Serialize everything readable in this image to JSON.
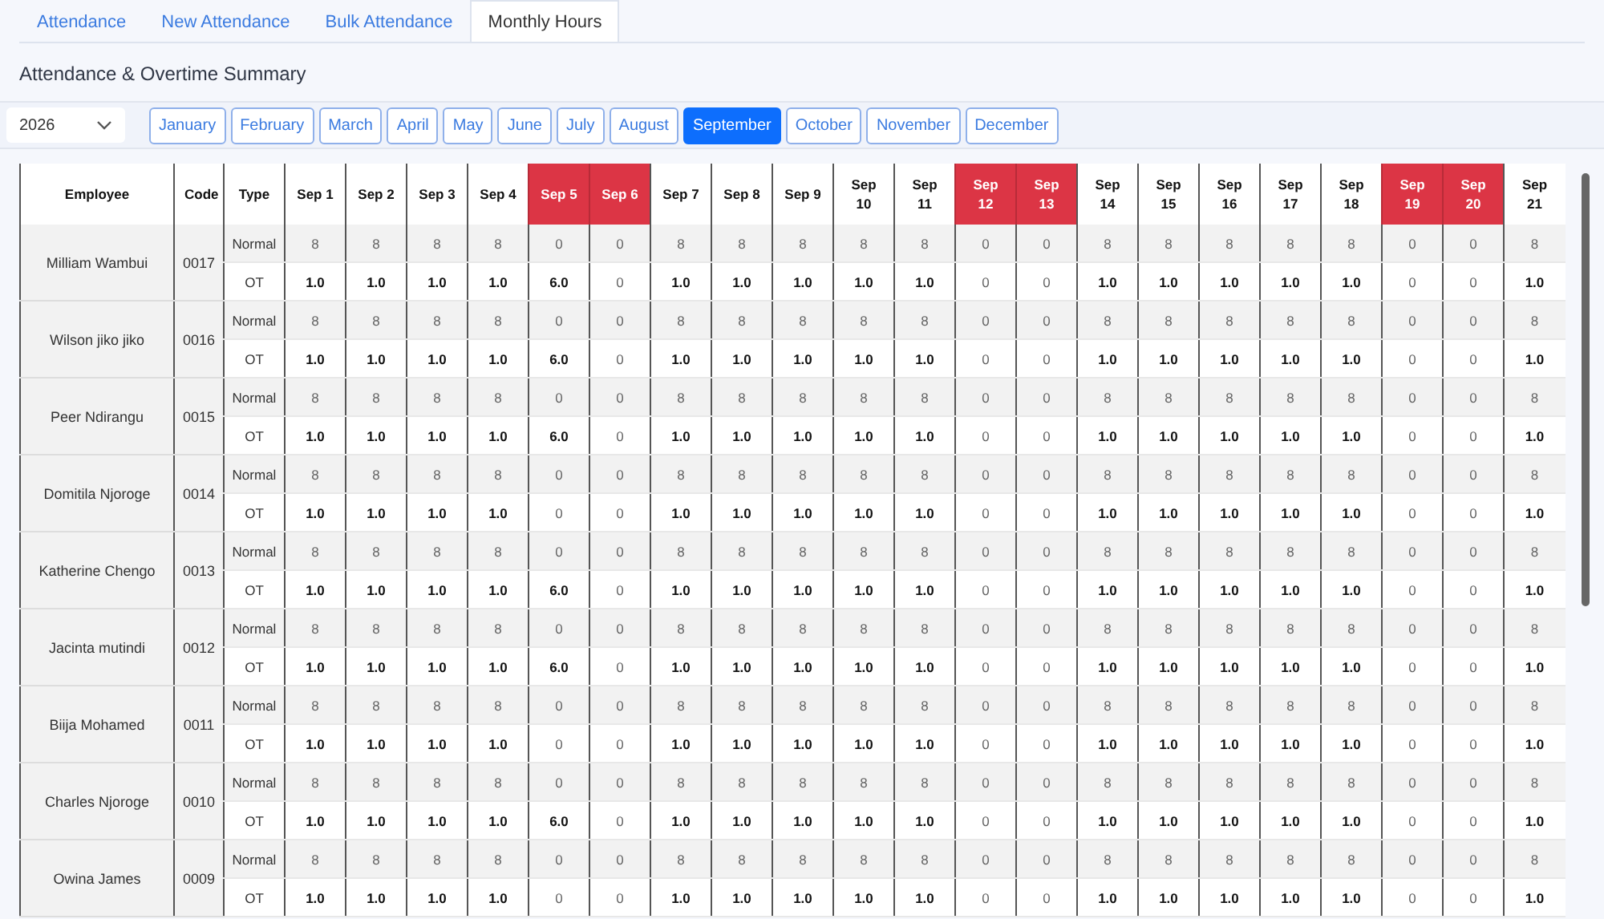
{
  "tabs": [
    {
      "label": "Attendance",
      "selected": false
    },
    {
      "label": "New Attendance",
      "selected": false
    },
    {
      "label": "Bulk Attendance",
      "selected": false
    },
    {
      "label": "Monthly Hours",
      "selected": true
    }
  ],
  "title": "Attendance & Overtime Summary",
  "year": "2026",
  "months": [
    {
      "label": "January",
      "selected": false
    },
    {
      "label": "February",
      "selected": false
    },
    {
      "label": "March",
      "selected": false
    },
    {
      "label": "April",
      "selected": false
    },
    {
      "label": "May",
      "selected": false
    },
    {
      "label": "June",
      "selected": false
    },
    {
      "label": "July",
      "selected": false
    },
    {
      "label": "August",
      "selected": false
    },
    {
      "label": "September",
      "selected": true
    },
    {
      "label": "October",
      "selected": false
    },
    {
      "label": "November",
      "selected": false
    },
    {
      "label": "December",
      "selected": false
    }
  ],
  "table": {
    "columns": [
      "Employee",
      "Code",
      "Type"
    ],
    "days": [
      {
        "label": "Sep 1",
        "weekend": false
      },
      {
        "label": "Sep 2",
        "weekend": false
      },
      {
        "label": "Sep 3",
        "weekend": false
      },
      {
        "label": "Sep 4",
        "weekend": false
      },
      {
        "label": "Sep 5",
        "weekend": true
      },
      {
        "label": "Sep 6",
        "weekend": true
      },
      {
        "label": "Sep 7",
        "weekend": false
      },
      {
        "label": "Sep 8",
        "weekend": false
      },
      {
        "label": "Sep 9",
        "weekend": false
      },
      {
        "label": "Sep 10",
        "weekend": false
      },
      {
        "label": "Sep 11",
        "weekend": false
      },
      {
        "label": "Sep 12",
        "weekend": true
      },
      {
        "label": "Sep 13",
        "weekend": true
      },
      {
        "label": "Sep 14",
        "weekend": false
      },
      {
        "label": "Sep 15",
        "weekend": false
      },
      {
        "label": "Sep 16",
        "weekend": false
      },
      {
        "label": "Sep 17",
        "weekend": false
      },
      {
        "label": "Sep 18",
        "weekend": false
      },
      {
        "label": "Sep 19",
        "weekend": true
      },
      {
        "label": "Sep 20",
        "weekend": true
      },
      {
        "label": "Sep 21",
        "weekend": false
      }
    ],
    "employees": [
      {
        "name": "Milliam Wambui",
        "code": "0017",
        "rows": [
          {
            "type": "Normal",
            "kind": "normal",
            "values": [
              "8",
              "8",
              "8",
              "8",
              "0",
              "0",
              "8",
              "8",
              "8",
              "8",
              "8",
              "0",
              "0",
              "8",
              "8",
              "8",
              "8",
              "8",
              "0",
              "0",
              "8"
            ]
          },
          {
            "type": "OT",
            "kind": "ot",
            "values": [
              "1.0",
              "1.0",
              "1.0",
              "1.0",
              "6.0",
              "0",
              "1.0",
              "1.0",
              "1.0",
              "1.0",
              "1.0",
              "0",
              "0",
              "1.0",
              "1.0",
              "1.0",
              "1.0",
              "1.0",
              "0",
              "0",
              "1.0"
            ]
          }
        ]
      },
      {
        "name": "Wilson jiko jiko",
        "code": "0016",
        "rows": [
          {
            "type": "Normal",
            "kind": "normal",
            "values": [
              "8",
              "8",
              "8",
              "8",
              "0",
              "0",
              "8",
              "8",
              "8",
              "8",
              "8",
              "0",
              "0",
              "8",
              "8",
              "8",
              "8",
              "8",
              "0",
              "0",
              "8"
            ]
          },
          {
            "type": "OT",
            "kind": "ot",
            "values": [
              "1.0",
              "1.0",
              "1.0",
              "1.0",
              "6.0",
              "0",
              "1.0",
              "1.0",
              "1.0",
              "1.0",
              "1.0",
              "0",
              "0",
              "1.0",
              "1.0",
              "1.0",
              "1.0",
              "1.0",
              "0",
              "0",
              "1.0"
            ]
          }
        ]
      },
      {
        "name": "Peer Ndirangu",
        "code": "0015",
        "rows": [
          {
            "type": "Normal",
            "kind": "normal",
            "values": [
              "8",
              "8",
              "8",
              "8",
              "0",
              "0",
              "8",
              "8",
              "8",
              "8",
              "8",
              "0",
              "0",
              "8",
              "8",
              "8",
              "8",
              "8",
              "0",
              "0",
              "8"
            ]
          },
          {
            "type": "OT",
            "kind": "ot",
            "values": [
              "1.0",
              "1.0",
              "1.0",
              "1.0",
              "6.0",
              "0",
              "1.0",
              "1.0",
              "1.0",
              "1.0",
              "1.0",
              "0",
              "0",
              "1.0",
              "1.0",
              "1.0",
              "1.0",
              "1.0",
              "0",
              "0",
              "1.0"
            ]
          }
        ]
      },
      {
        "name": "Domitila Njoroge",
        "code": "0014",
        "rows": [
          {
            "type": "Normal",
            "kind": "normal",
            "values": [
              "8",
              "8",
              "8",
              "8",
              "0",
              "0",
              "8",
              "8",
              "8",
              "8",
              "8",
              "0",
              "0",
              "8",
              "8",
              "8",
              "8",
              "8",
              "0",
              "0",
              "8"
            ]
          },
          {
            "type": "OT",
            "kind": "ot",
            "values": [
              "1.0",
              "1.0",
              "1.0",
              "1.0",
              "0",
              "0",
              "1.0",
              "1.0",
              "1.0",
              "1.0",
              "1.0",
              "0",
              "0",
              "1.0",
              "1.0",
              "1.0",
              "1.0",
              "1.0",
              "0",
              "0",
              "1.0"
            ]
          }
        ]
      },
      {
        "name": "Katherine Chengo",
        "code": "0013",
        "rows": [
          {
            "type": "Normal",
            "kind": "normal",
            "values": [
              "8",
              "8",
              "8",
              "8",
              "0",
              "0",
              "8",
              "8",
              "8",
              "8",
              "8",
              "0",
              "0",
              "8",
              "8",
              "8",
              "8",
              "8",
              "0",
              "0",
              "8"
            ]
          },
          {
            "type": "OT",
            "kind": "ot",
            "values": [
              "1.0",
              "1.0",
              "1.0",
              "1.0",
              "6.0",
              "0",
              "1.0",
              "1.0",
              "1.0",
              "1.0",
              "1.0",
              "0",
              "0",
              "1.0",
              "1.0",
              "1.0",
              "1.0",
              "1.0",
              "0",
              "0",
              "1.0"
            ]
          }
        ]
      },
      {
        "name": "Jacinta mutindi",
        "code": "0012",
        "rows": [
          {
            "type": "Normal",
            "kind": "normal",
            "values": [
              "8",
              "8",
              "8",
              "8",
              "0",
              "0",
              "8",
              "8",
              "8",
              "8",
              "8",
              "0",
              "0",
              "8",
              "8",
              "8",
              "8",
              "8",
              "0",
              "0",
              "8"
            ]
          },
          {
            "type": "OT",
            "kind": "ot",
            "values": [
              "1.0",
              "1.0",
              "1.0",
              "1.0",
              "6.0",
              "0",
              "1.0",
              "1.0",
              "1.0",
              "1.0",
              "1.0",
              "0",
              "0",
              "1.0",
              "1.0",
              "1.0",
              "1.0",
              "1.0",
              "0",
              "0",
              "1.0"
            ]
          }
        ]
      },
      {
        "name": "Biija Mohamed",
        "code": "0011",
        "rows": [
          {
            "type": "Normal",
            "kind": "normal",
            "values": [
              "8",
              "8",
              "8",
              "8",
              "0",
              "0",
              "8",
              "8",
              "8",
              "8",
              "8",
              "0",
              "0",
              "8",
              "8",
              "8",
              "8",
              "8",
              "0",
              "0",
              "8"
            ]
          },
          {
            "type": "OT",
            "kind": "ot",
            "values": [
              "1.0",
              "1.0",
              "1.0",
              "1.0",
              "0",
              "0",
              "1.0",
              "1.0",
              "1.0",
              "1.0",
              "1.0",
              "0",
              "0",
              "1.0",
              "1.0",
              "1.0",
              "1.0",
              "1.0",
              "0",
              "0",
              "1.0"
            ]
          }
        ]
      },
      {
        "name": "Charles Njoroge",
        "code": "0010",
        "rows": [
          {
            "type": "Normal",
            "kind": "normal",
            "values": [
              "8",
              "8",
              "8",
              "8",
              "0",
              "0",
              "8",
              "8",
              "8",
              "8",
              "8",
              "0",
              "0",
              "8",
              "8",
              "8",
              "8",
              "8",
              "0",
              "0",
              "8"
            ]
          },
          {
            "type": "OT",
            "kind": "ot",
            "values": [
              "1.0",
              "1.0",
              "1.0",
              "1.0",
              "6.0",
              "0",
              "1.0",
              "1.0",
              "1.0",
              "1.0",
              "1.0",
              "0",
              "0",
              "1.0",
              "1.0",
              "1.0",
              "1.0",
              "1.0",
              "0",
              "0",
              "1.0"
            ]
          }
        ]
      },
      {
        "name": "Owina James",
        "code": "0009",
        "rows": [
          {
            "type": "Normal",
            "kind": "normal",
            "values": [
              "8",
              "8",
              "8",
              "8",
              "0",
              "0",
              "8",
              "8",
              "8",
              "8",
              "8",
              "0",
              "0",
              "8",
              "8",
              "8",
              "8",
              "8",
              "0",
              "0",
              "8"
            ]
          },
          {
            "type": "OT",
            "kind": "ot",
            "values": [
              "1.0",
              "1.0",
              "1.0",
              "1.0",
              "0",
              "0",
              "1.0",
              "1.0",
              "1.0",
              "1.0",
              "1.0",
              "0",
              "0",
              "1.0",
              "1.0",
              "1.0",
              "1.0",
              "1.0",
              "0",
              "0",
              "1.0"
            ]
          }
        ]
      }
    ]
  }
}
